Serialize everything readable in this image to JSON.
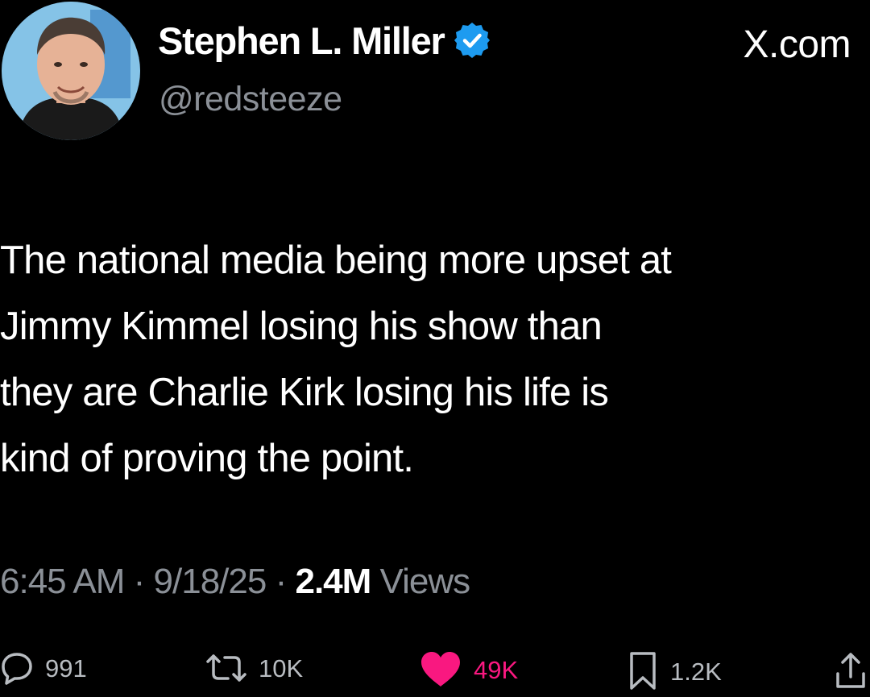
{
  "author": {
    "name": "Stephen L. Miller",
    "handle": "@redsteeze",
    "verified": true
  },
  "source_label": "X.com",
  "tweet": {
    "text": "The national media being more upset at\nJimmy Kimmel losing his show than\nthey are Charlie Kirk losing his life is\nkind of proving the point."
  },
  "meta": {
    "time": "6:45 AM",
    "separator": " · ",
    "date": "9/18/25",
    "views_count": "2.4M",
    "views_label": " Views"
  },
  "actions": {
    "replies": "991",
    "reposts": "10K",
    "likes": "49K",
    "bookmarks": "1.2K"
  },
  "icons": {
    "verified": "verified-badge-icon",
    "reply": "reply-icon",
    "repost": "repost-icon",
    "like": "heart-icon",
    "bookmark": "bookmark-icon",
    "share": "share-icon"
  },
  "colors": {
    "background": "#000000",
    "text": "#ffffff",
    "secondary_text": "#8b9097",
    "verified_badge": "#1d9bf0",
    "like": "#f91880"
  }
}
